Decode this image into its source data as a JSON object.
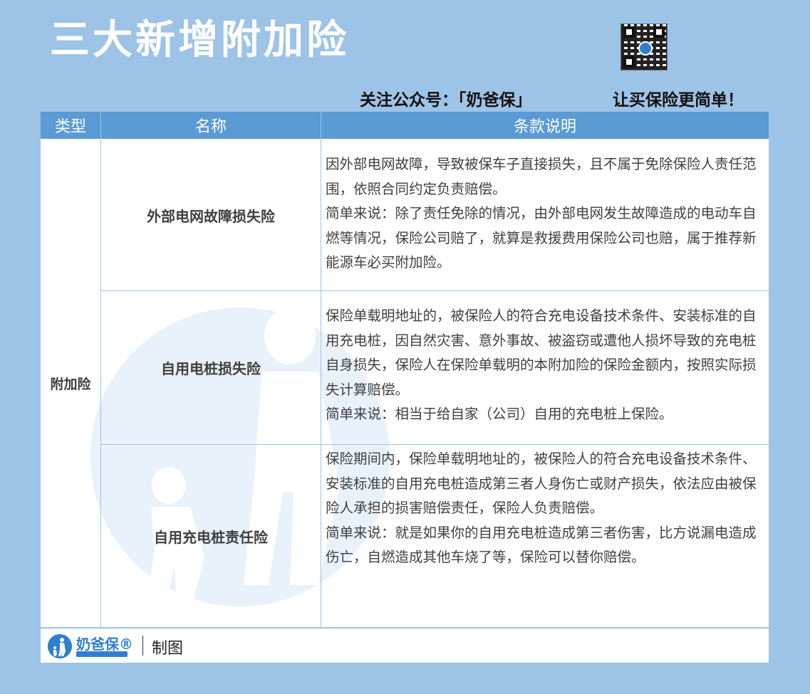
{
  "header": {
    "title": "三大新增附加险",
    "follow_text": "关注公众号：「奶爸保」",
    "slogan": "让买保险更简单！",
    "qr_icon": "qr-code-icon"
  },
  "table": {
    "columns": [
      "类型",
      "名称",
      "条款说明"
    ],
    "type_label": "附加险",
    "rows": [
      {
        "name": "外部电网故障损失险",
        "desc": [
          "因外部电网故障，导致被保车子直接损失，且不属于免除保险人责任范围，依照合同约定负责赔偿。",
          "简单来说：除了责任免除的情况，由外部电网发生故障造成的电动车自燃等情况，保险公司赔了，就算是救援费用保险公司也赔，属于推荐新能源车必买附加险。"
        ]
      },
      {
        "name": "自用电桩损失险",
        "desc": [
          "保险单载明地址的，被保险人的符合充电设备技术条件、安装标准的自用充电桩，因自然灾害、意外事故、被盗窃或遭他人损坏导致的充电桩自身损失，保险人在保险单载明的本附加险的保险金额内，按照实际损失计算赔偿。",
          "简单来说：相当于给自家（公司）自用的充电桩上保险。"
        ]
      },
      {
        "name": "自用充电桩责任险",
        "desc": [
          "保险期间内，保险单载明地址的，被保险人的符合充电设备技术条件、安装标准的自用充电桩造成第三者人身伤亡或财产损失，依法应由被保险人承担的损害赔偿责任，保险人负责赔偿。",
          "简单来说：就是如果你的自用充电桩造成第三者伤害，比方说漏电造成伤亡，自燃造成其他车烧了等，保险可以替你赔偿。"
        ]
      }
    ]
  },
  "footer": {
    "logo_text": "奶爸保®",
    "logo_icon": "parent-child-logo-icon",
    "label": "制图"
  },
  "colors": {
    "background": "#9dc3e6",
    "header_fill": "#5b9bd5",
    "brand": "#2f7fd0"
  }
}
